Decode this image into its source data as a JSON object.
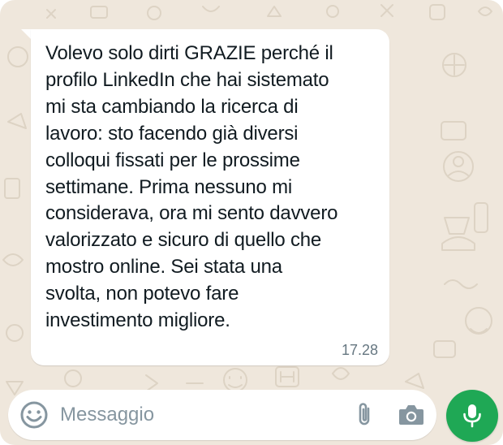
{
  "message": {
    "text": "Volevo solo dirti GRAZIE perché il\nprofilo LinkedIn che hai sistemato\nmi sta cambiando la ricerca di\nlavoro: sto facendo già diversi\ncolloqui fissati per le prossime\nsettimane. Prima nessuno mi\nconsiderava, ora mi sento davvero\nvalorizzato e sicuro di quello che\nmostro online. Sei stata una\nsvolta, non potevo fare\ninvestimento migliore.",
    "time": "17.28",
    "direction": "incoming"
  },
  "composer": {
    "placeholder": "Messaggio",
    "value": "",
    "icons": {
      "emoji": "emoji-icon",
      "attach": "paperclip-icon",
      "camera": "camera-icon",
      "mic": "microphone-icon"
    }
  },
  "colors": {
    "wallpaper": "#efe7dc",
    "bubble": "#ffffff",
    "text": "#111b21",
    "meta": "#667781",
    "icon": "#8696a0",
    "mic_button": "#1fa855"
  }
}
